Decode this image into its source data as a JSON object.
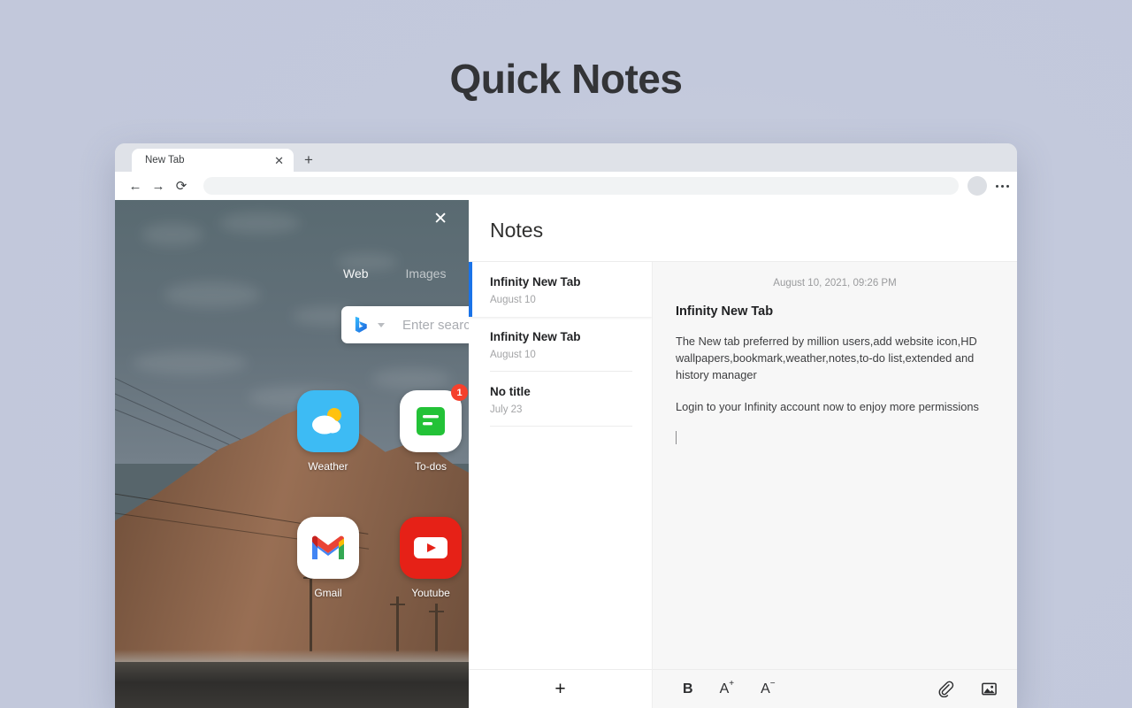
{
  "page": {
    "title": "Quick Notes"
  },
  "browser": {
    "tab": {
      "title": "New Tab",
      "close_label": "✕"
    },
    "new_tab_label": "+",
    "nav": {
      "back": "←",
      "forward": "→",
      "reload": "⟳"
    },
    "omnibox_value": ""
  },
  "newtab": {
    "close_label": "✕",
    "search_tabs": [
      {
        "label": "Web",
        "active": true
      },
      {
        "label": "Images",
        "active": false
      }
    ],
    "search": {
      "engine": "bing-icon",
      "placeholder": "Enter search"
    },
    "apps": [
      {
        "label": "Weather",
        "icon": "weather-icon",
        "badge": ""
      },
      {
        "label": "To-dos",
        "icon": "todos-icon",
        "badge": "1"
      },
      {
        "label": "Gmail",
        "icon": "gmail-icon",
        "badge": ""
      },
      {
        "label": "Youtube",
        "icon": "youtube-icon",
        "badge": ""
      }
    ]
  },
  "notes": {
    "header_title": "Notes",
    "add_button_label": "+",
    "list": [
      {
        "title": "Infinity New Tab",
        "date": "August 10",
        "selected": true
      },
      {
        "title": "Infinity New Tab",
        "date": "August 10",
        "selected": false
      },
      {
        "title": "No title",
        "date": "July 23",
        "selected": false
      }
    ],
    "detail": {
      "timestamp": "August 10, 2021, 09:26 PM",
      "title": "Infinity New Tab",
      "paragraphs": [
        "The New tab preferred by million users,add website icon,HD wallpapers,bookmark,weather,notes,to-do list,extended and history manager",
        "Login to your Infinity account now to enjoy more permissions"
      ]
    },
    "format_bar": {
      "bold": "B",
      "font_increase_base": "A",
      "font_increase_sup": "+",
      "font_decrease_base": "A",
      "font_decrease_sup": "−",
      "link_icon": "paperclip-icon",
      "image_icon": "image-icon"
    }
  },
  "colors": {
    "accent": "#1a73e8",
    "badge": "#f5402c",
    "page_bg": "#c3c9dc"
  }
}
